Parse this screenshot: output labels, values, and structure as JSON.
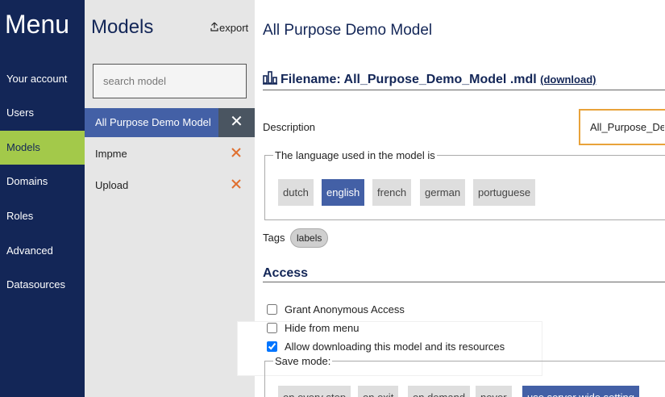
{
  "nav": {
    "title": "Menu",
    "items": [
      {
        "label": "Your account"
      },
      {
        "label": "Users"
      },
      {
        "label": "Models"
      },
      {
        "label": "Domains"
      },
      {
        "label": "Roles"
      },
      {
        "label": "Advanced"
      },
      {
        "label": "Datasources"
      }
    ],
    "active": "Models"
  },
  "models_panel": {
    "title": "Models",
    "export_label": "export",
    "search_placeholder": "search model",
    "items": [
      {
        "label": "All Purpose Demo Model"
      },
      {
        "label": "Impme"
      },
      {
        "label": "Upload"
      }
    ],
    "close_glyph": "✕"
  },
  "main": {
    "title": "All Purpose Demo Model",
    "filename_label": "Filename: All_Purpose_Demo_Model .mdl",
    "download_label": "(download)",
    "description_label": "Description",
    "description_value": "All_Purpose_Demo_Model",
    "language_legend": "The language used in the model is",
    "languages": [
      {
        "label": "dutch"
      },
      {
        "label": "english"
      },
      {
        "label": "french"
      },
      {
        "label": "german"
      },
      {
        "label": "portuguese"
      }
    ],
    "selected_language": "english",
    "tags_label": "Tags",
    "tags": [
      {
        "label": "labels"
      }
    ],
    "access_title": "Access",
    "checkboxes": [
      {
        "label": "Grant Anonymous Access",
        "checked": false
      },
      {
        "label": "Hide from menu",
        "checked": false
      },
      {
        "label": "Allow downloading this model and its resources",
        "checked": true
      }
    ],
    "save_mode_legend": "Save mode:",
    "save_modes": [
      {
        "label": "on every step"
      },
      {
        "label": "on exit"
      },
      {
        "label": "on demand"
      },
      {
        "label": "never"
      },
      {
        "label": "use server wide setting"
      }
    ],
    "selected_save_mode": "use server wide setting"
  },
  "colors": {
    "nav_bg": "#132657",
    "nav_active": "#a3c94a",
    "accent": "#4360a6",
    "delete_icon": "#e07030",
    "focus_border": "#e8a23a"
  }
}
